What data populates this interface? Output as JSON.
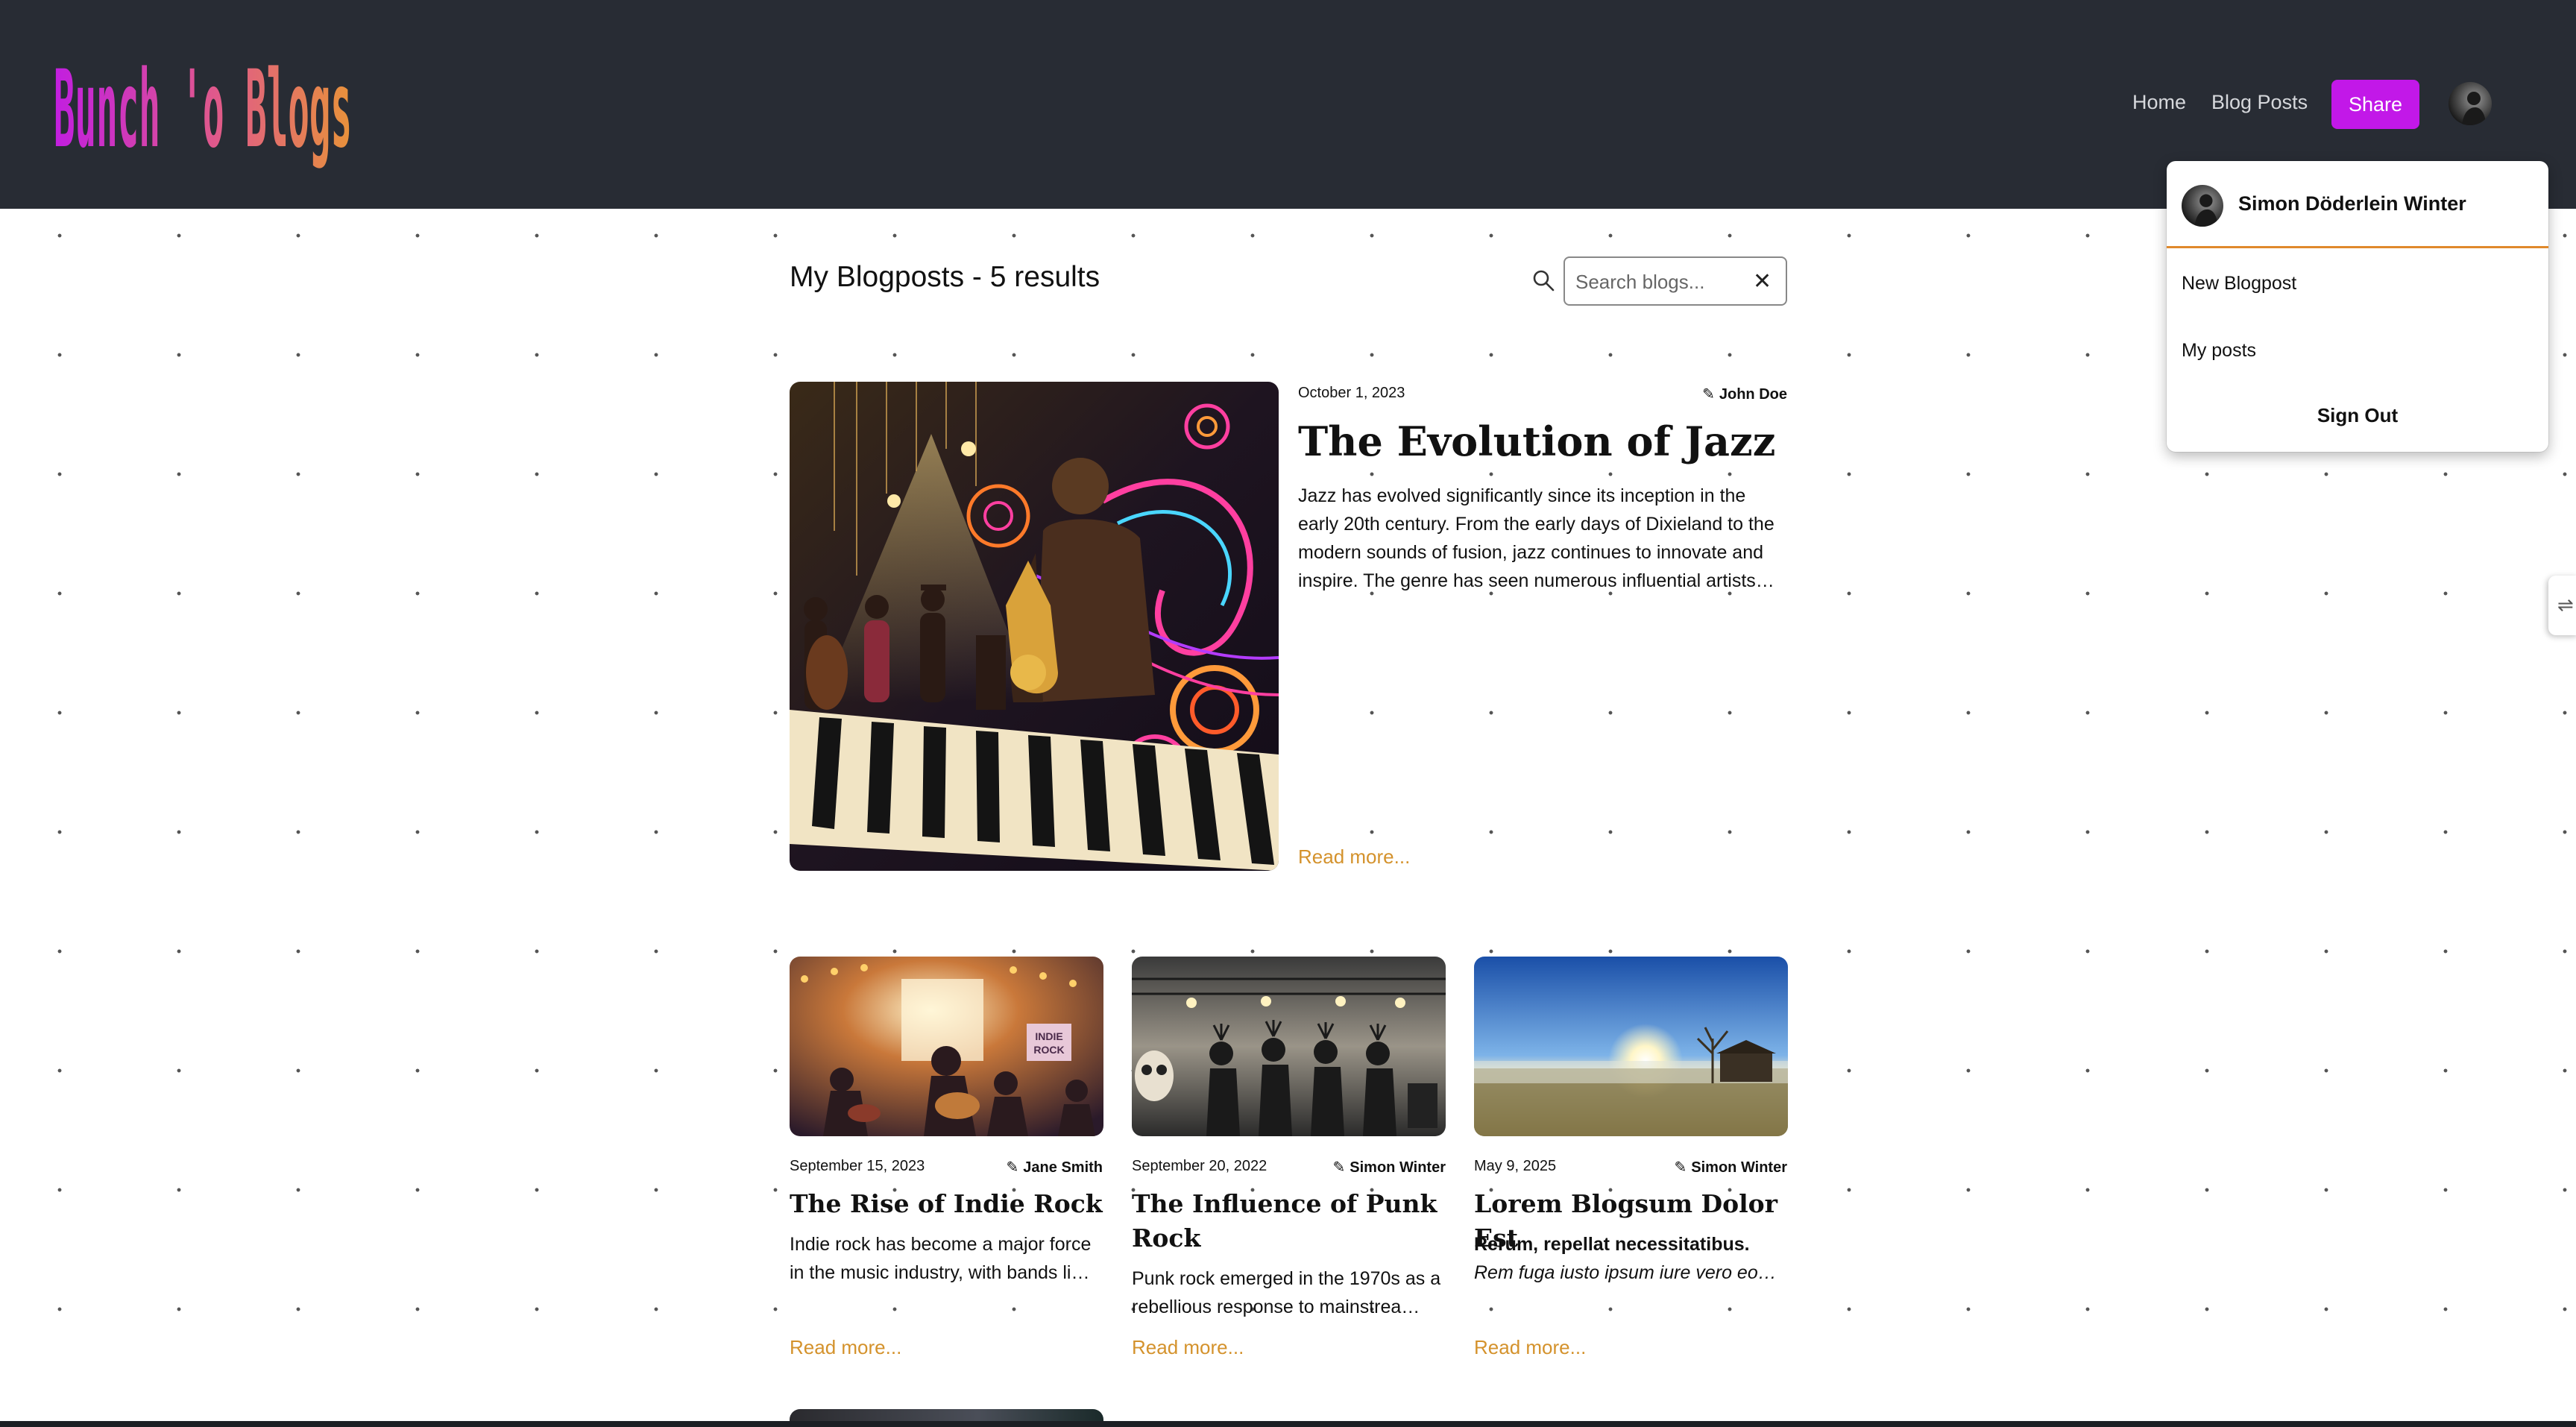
{
  "header": {
    "logo_text": "Bunch 'o Blogs",
    "nav": {
      "home": "Home",
      "blog_posts": "Blog Posts",
      "share": "Share"
    }
  },
  "user_menu": {
    "user_name": "Simon Döderlein Winter",
    "items": {
      "new_blogpost": "New Blogpost",
      "my_posts": "My posts"
    },
    "sign_out": "Sign Out"
  },
  "main": {
    "title": "My Blogposts - 5 results",
    "search": {
      "placeholder": "Search blogs...",
      "value": ""
    },
    "clear_icon": "✕"
  },
  "featured": {
    "date": "October 1, 2023",
    "author": "John Doe",
    "title": "The Evolution of Jazz",
    "excerpt": "Jazz has evolved significantly since its inception in the early 20th century. From the early days of Dixieland to the modern sounds of fusion, jazz continues to innovate and inspire. The genre has seen numerous influential artists…",
    "read_more": "Read more...",
    "image_icon": "jazz-saxophone-illustration"
  },
  "posts": [
    {
      "date": "September 15, 2023",
      "author": "Jane Smith",
      "title": "The Rise of Indie Rock",
      "excerpt": "Indie rock has become a major force in the music industry, with bands li…",
      "read_more": "Read more...",
      "image_icon": "indie-rock-band-illustration",
      "image_sign": "INDIE ROCK"
    },
    {
      "date": "September 20, 2022",
      "author": "Simon Winter",
      "title": "The Influence of Punk Rock",
      "excerpt": "Punk rock emerged in the 1970s as a rebellious response to mainstrea…",
      "read_more": "Read more...",
      "image_icon": "punk-band-illustration"
    },
    {
      "date": "May 9, 2025",
      "author": "Simon Winter",
      "title": "Lorem Blogsum Dolor Est",
      "excerpt_bold": "Rerum, repellat necessitatibus.",
      "excerpt_italic": "Rem fuga iusto ipsum iure vero eo…",
      "read_more": "Read more...",
      "image_icon": "sunrise-meadow-photo"
    }
  ],
  "icons": {
    "search": "search-icon",
    "pencil": "pencil-icon",
    "side_tab": "sidebar-toggle-icon"
  },
  "colors": {
    "topbar": "#282c34",
    "accent_share": "#c218e8",
    "read_more": "#d4922c",
    "logo_gradient": [
      "#c21ee0",
      "#e05a8a",
      "#e8923a"
    ]
  }
}
